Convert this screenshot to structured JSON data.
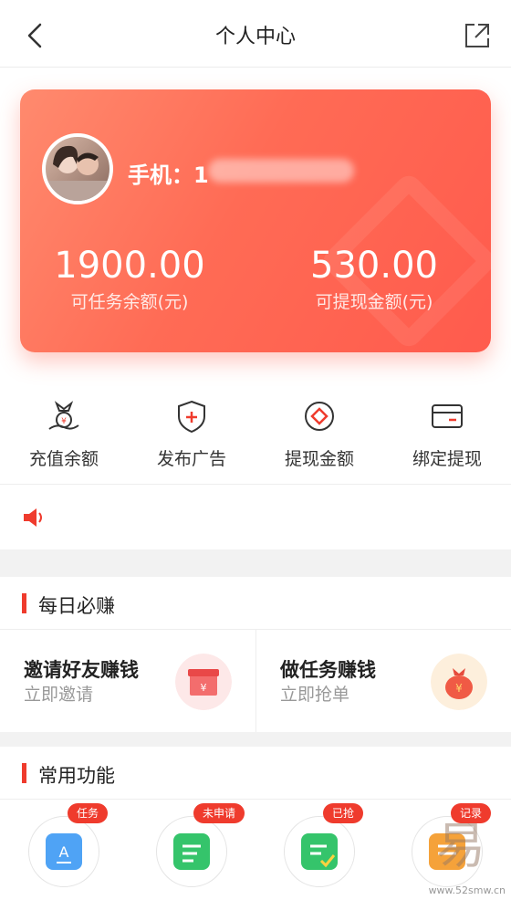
{
  "header": {
    "title": "个人中心"
  },
  "card": {
    "phone_label": "手机：1",
    "balance": {
      "amount": "1900.00",
      "label": "可任务余额(元)"
    },
    "withdrawable": {
      "amount": "530.00",
      "label": "可提现金额(元)"
    }
  },
  "quick_actions": [
    {
      "label": "充值余额",
      "icon": "money-bag-icon"
    },
    {
      "label": "发布广告",
      "icon": "shield-plus-icon"
    },
    {
      "label": "提现金额",
      "icon": "coin-icon"
    },
    {
      "label": "绑定提现",
      "icon": "card-icon"
    }
  ],
  "daily": {
    "title": "每日必赚",
    "items": [
      {
        "title": "邀请好友赚钱",
        "subtitle": "立即邀请",
        "icon": "red-envelope-icon"
      },
      {
        "title": "做任务赚钱",
        "subtitle": "立即抢单",
        "icon": "money-sack-icon"
      }
    ]
  },
  "common": {
    "title": "常用功能",
    "badges": [
      "任务",
      "未申请",
      "已抢",
      "记录"
    ]
  },
  "watermark": {
    "url": "www.52smw.cn"
  },
  "colors": {
    "accent": "#ef3b2d",
    "card": "#ff6b55"
  }
}
